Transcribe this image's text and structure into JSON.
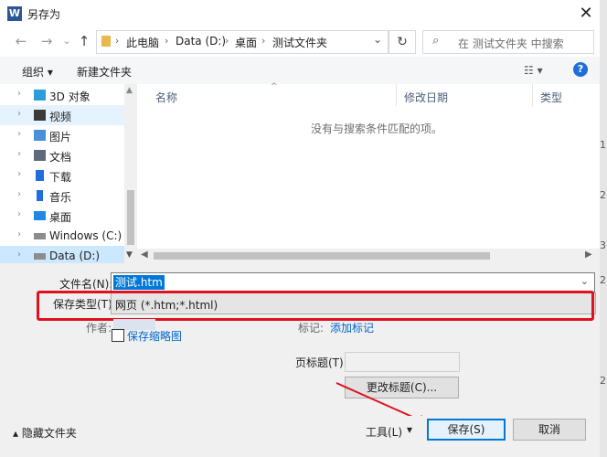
{
  "window": {
    "title": "另存为",
    "app_icon": "W",
    "close_glyph": "✕"
  },
  "nav": {
    "back_glyph": "←",
    "forward_glyph": "→",
    "recent_glyph": "⌄",
    "up_glyph": "↑",
    "breadcrumb": [
      "此电脑",
      "Data (D:)",
      "桌面",
      "测试文件夹"
    ],
    "breadcrumb_sep": "›",
    "refresh_glyph": "↻",
    "search_placeholder": "在 测试文件夹 中搜索",
    "search_glyph": "⌕"
  },
  "toolbar": {
    "organize": "组织 ▾",
    "new_folder": "新建文件夹",
    "view_glyph": "☷ ▾",
    "help": "?"
  },
  "sidebar": {
    "items": [
      {
        "label": "3D 对象",
        "icon": "cube-icon",
        "color": "#2d9cdb"
      },
      {
        "label": "视频",
        "icon": "video-icon",
        "color": "#3a3a3a"
      },
      {
        "label": "图片",
        "icon": "picture-icon",
        "color": "#4a90d9"
      },
      {
        "label": "文档",
        "icon": "document-icon",
        "color": "#5f6b7a"
      },
      {
        "label": "下载",
        "icon": "download-icon",
        "color": "#1e6fd9"
      },
      {
        "label": "音乐",
        "icon": "music-icon",
        "color": "#1e6fd9"
      },
      {
        "label": "桌面",
        "icon": "desktop-icon",
        "color": "#1e88e5"
      },
      {
        "label": "Windows (C:)",
        "icon": "drive-icon",
        "color": "#777777"
      },
      {
        "label": "Data (D:)",
        "icon": "drive-icon",
        "color": "#777777"
      }
    ],
    "chevron": "›"
  },
  "filelist": {
    "columns": [
      "名称",
      "修改日期",
      "类型"
    ],
    "empty_message": "没有与搜索条件匹配的项。",
    "sort_glyph": "^"
  },
  "form": {
    "filename_label": "文件名(N):",
    "filename_value": "测试.htm",
    "filetype_label": "保存类型(T):",
    "filetype_value": "网页 (*.htm;*.html)",
    "author_label": "作者:",
    "tags_label": "标记:",
    "add_tag": "添加标记",
    "save_thumbnail": "保存缩略图",
    "page_title_label": "页标题(T):",
    "change_title": "更改标题(C)...",
    "dropdown_glyph": "⌄"
  },
  "footer": {
    "hide_folders": "▴ 隐藏文件夹",
    "tools": "工具(L)",
    "tools_glyph": "▾",
    "save": "保存(S)",
    "cancel": "取消"
  },
  "background": {
    "digits": [
      "1",
      "2",
      "3",
      "2",
      "2"
    ]
  },
  "colors": {
    "accent": "#0078d7",
    "highlight_border": "#e0101e"
  }
}
